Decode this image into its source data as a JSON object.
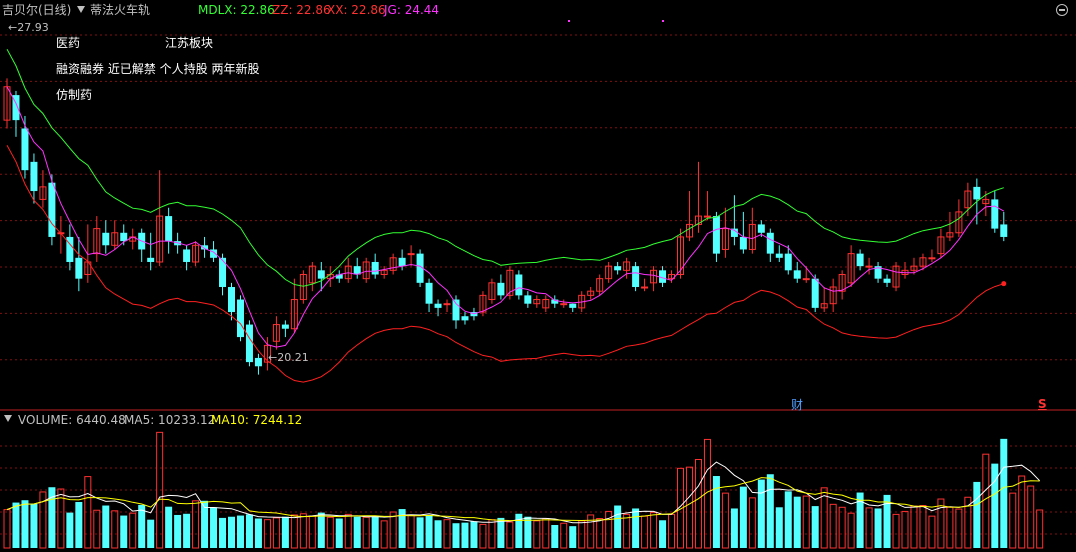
{
  "header": {
    "stock_title": "吉贝尔(日线)",
    "indicator_name": "蒂法火车轨",
    "mdlx": "MDLX: 22.86",
    "zz": "ZZ: 22.86",
    "xx": "XX: 22.86",
    "jg": "JG: 24.44"
  },
  "tags": {
    "pharma": "医药",
    "jiangsu": "江苏板块",
    "concepts": "融资融券 近已解禁 个人持股 两年新股",
    "generic": "仿制药"
  },
  "markers": {
    "high_label": "27.93",
    "low_label": "20.21",
    "finance_marker": "财",
    "s_marker": "S"
  },
  "volume_header": {
    "volume": "VOLUME: 6440.48",
    "ma5": "MA5: 10233.12",
    "ma10": "MA10: 7244.12"
  },
  "colors": {
    "up": "#ff3232",
    "down": "#54ffff",
    "ma_magenta": "#ff32ff",
    "line_red": "#ff2020",
    "line_green": "#32ff32",
    "ma10_yellow": "#ffff00",
    "grid": "#801010"
  },
  "chart_data": [
    {
      "type": "candlestick",
      "title": "吉贝尔(日线)",
      "ylim": [
        19.3,
        28.6
      ],
      "high": 27.93,
      "low": 20.21,
      "candles": [
        [
          26.2,
          27.0,
          26.0,
          27.2
        ],
        [
          26.8,
          26.2,
          25.8,
          26.9
        ],
        [
          26.0,
          25.0,
          24.8,
          26.3
        ],
        [
          25.2,
          24.5,
          24.2,
          25.4
        ],
        [
          24.3,
          24.6,
          24.1,
          25.0
        ],
        [
          24.7,
          23.4,
          23.2,
          24.9
        ],
        [
          23.5,
          23.5,
          23.0,
          23.9
        ],
        [
          23.4,
          22.8,
          22.6,
          23.7
        ],
        [
          22.9,
          22.4,
          22.1,
          23.4
        ],
        [
          22.5,
          22.8,
          22.3,
          23.7
        ],
        [
          23.0,
          23.6,
          22.8,
          23.9
        ],
        [
          23.5,
          23.2,
          23.0,
          23.8
        ],
        [
          23.2,
          23.5,
          23.1,
          23.8
        ],
        [
          23.5,
          23.3,
          23.2,
          23.7
        ],
        [
          23.3,
          23.4,
          23.1,
          23.6
        ],
        [
          23.5,
          23.1,
          22.8,
          23.6
        ],
        [
          22.9,
          22.8,
          22.6,
          23.5
        ],
        [
          22.8,
          23.9,
          22.7,
          25.0
        ],
        [
          23.9,
          23.3,
          23.0,
          24.1
        ],
        [
          23.3,
          23.2,
          23.0,
          23.5
        ],
        [
          23.1,
          22.8,
          22.6,
          23.2
        ],
        [
          22.8,
          23.2,
          22.7,
          23.3
        ],
        [
          23.2,
          23.1,
          22.9,
          23.4
        ],
        [
          23.1,
          22.9,
          22.8,
          23.3
        ],
        [
          22.9,
          22.2,
          22.0,
          23.0
        ],
        [
          22.2,
          21.6,
          21.4,
          22.3
        ],
        [
          21.9,
          21.0,
          20.9,
          22.0
        ],
        [
          21.3,
          20.4,
          20.3,
          21.4
        ],
        [
          20.5,
          20.3,
          20.1,
          20.6
        ],
        [
          20.4,
          20.8,
          20.2,
          21.0
        ],
        [
          20.9,
          21.3,
          20.7,
          21.5
        ],
        [
          21.3,
          21.2,
          21.0,
          21.4
        ],
        [
          21.2,
          21.9,
          21.1,
          22.4
        ],
        [
          21.9,
          22.5,
          21.8,
          22.6
        ],
        [
          22.3,
          22.7,
          22.1,
          22.8
        ],
        [
          22.6,
          22.4,
          22.1,
          22.8
        ],
        [
          22.4,
          22.5,
          22.2,
          22.7
        ],
        [
          22.5,
          22.4,
          22.3,
          22.6
        ],
        [
          22.4,
          22.7,
          22.3,
          22.9
        ],
        [
          22.7,
          22.5,
          22.4,
          22.9
        ],
        [
          22.4,
          22.8,
          22.3,
          22.9
        ],
        [
          22.8,
          22.5,
          22.4,
          23.0
        ],
        [
          22.5,
          22.6,
          22.4,
          22.7
        ],
        [
          22.6,
          22.9,
          22.5,
          23.0
        ],
        [
          22.9,
          22.7,
          22.6,
          23.1
        ],
        [
          23.0,
          23.0,
          22.7,
          23.2
        ],
        [
          23.0,
          22.3,
          22.2,
          23.1
        ],
        [
          22.3,
          21.8,
          21.6,
          22.4
        ],
        [
          21.8,
          21.7,
          21.5,
          21.9
        ],
        [
          21.8,
          21.8,
          21.6,
          21.9
        ],
        [
          21.9,
          21.4,
          21.2,
          22.0
        ],
        [
          21.5,
          21.4,
          21.3,
          21.6
        ],
        [
          21.6,
          21.5,
          21.4,
          21.7
        ],
        [
          21.6,
          22.0,
          21.5,
          22.1
        ],
        [
          21.9,
          22.3,
          21.8,
          22.4
        ],
        [
          22.3,
          22.0,
          21.9,
          22.5
        ],
        [
          22.0,
          22.6,
          21.9,
          22.7
        ],
        [
          22.5,
          22.0,
          21.9,
          22.6
        ],
        [
          22.0,
          21.8,
          21.7,
          22.1
        ],
        [
          21.8,
          21.9,
          21.7,
          22.0
        ],
        [
          21.7,
          21.9,
          21.6,
          22.0
        ],
        [
          21.9,
          21.8,
          21.7,
          22.0
        ],
        [
          21.8,
          21.8,
          21.7,
          21.9
        ],
        [
          21.8,
          21.7,
          21.6,
          21.8
        ],
        [
          21.7,
          22.0,
          21.6,
          22.1
        ],
        [
          22.0,
          22.1,
          21.9,
          22.2
        ],
        [
          22.1,
          22.4,
          22.0,
          22.5
        ],
        [
          22.4,
          22.7,
          22.3,
          22.8
        ],
        [
          22.7,
          22.6,
          22.5,
          22.8
        ],
        [
          22.6,
          22.8,
          22.4,
          22.9
        ],
        [
          22.7,
          22.2,
          22.1,
          22.8
        ],
        [
          22.2,
          22.2,
          22.1,
          22.4
        ],
        [
          22.3,
          22.6,
          22.1,
          22.7
        ],
        [
          22.6,
          22.3,
          22.2,
          22.7
        ],
        [
          22.4,
          22.5,
          22.3,
          22.6
        ],
        [
          22.5,
          23.4,
          22.4,
          23.6
        ],
        [
          23.4,
          23.7,
          23.3,
          24.5
        ],
        [
          23.7,
          23.9,
          23.5,
          25.2
        ],
        [
          23.9,
          23.9,
          23.8,
          24.5
        ],
        [
          23.9,
          23.0,
          22.8,
          24.0
        ],
        [
          23.1,
          23.6,
          22.9,
          24.1
        ],
        [
          23.6,
          23.4,
          23.2,
          24.4
        ],
        [
          23.4,
          23.1,
          23.0,
          24.0
        ],
        [
          23.1,
          23.7,
          23.0,
          24.1
        ],
        [
          23.7,
          23.5,
          23.4,
          23.8
        ],
        [
          23.5,
          23.0,
          22.8,
          23.6
        ],
        [
          23.0,
          22.9,
          22.8,
          23.2
        ],
        [
          23.0,
          22.6,
          22.5,
          23.2
        ],
        [
          22.6,
          22.4,
          22.3,
          22.8
        ],
        [
          22.4,
          22.4,
          22.3,
          22.7
        ],
        [
          22.4,
          21.7,
          21.6,
          22.5
        ],
        [
          21.7,
          21.8,
          21.6,
          22.2
        ],
        [
          21.8,
          22.2,
          21.6,
          22.4
        ],
        [
          22.1,
          22.5,
          21.9,
          22.6
        ],
        [
          22.3,
          23.0,
          22.2,
          23.2
        ],
        [
          23.0,
          22.7,
          22.6,
          23.1
        ],
        [
          22.7,
          22.7,
          22.5,
          22.9
        ],
        [
          22.7,
          22.4,
          22.3,
          22.8
        ],
        [
          22.4,
          22.3,
          22.2,
          22.5
        ],
        [
          22.2,
          22.7,
          22.1,
          22.8
        ],
        [
          22.5,
          22.6,
          22.4,
          22.8
        ],
        [
          22.6,
          22.7,
          22.5,
          22.9
        ],
        [
          22.7,
          22.9,
          22.6,
          23.0
        ],
        [
          22.9,
          22.9,
          22.8,
          23.1
        ],
        [
          23.0,
          23.4,
          22.9,
          23.6
        ],
        [
          23.4,
          23.5,
          23.3,
          24.0
        ],
        [
          23.5,
          24.0,
          23.4,
          24.3
        ],
        [
          24.1,
          24.5,
          23.9,
          24.7
        ],
        [
          24.6,
          24.3,
          23.7,
          24.8
        ],
        [
          24.2,
          24.3,
          23.9,
          24.5
        ],
        [
          24.3,
          23.6,
          23.5,
          24.5
        ],
        [
          23.7,
          23.4,
          23.3,
          24.0
        ]
      ]
    },
    {
      "type": "bar",
      "title": "VOLUME",
      "series": [
        {
          "name": "VOLUME",
          "values": [
            6500,
            7700,
            8100,
            7500,
            9500,
            10300,
            10000,
            6000,
            7800,
            12100,
            6400,
            7200,
            6300,
            5500,
            5900,
            7300,
            4800,
            19600,
            7000,
            5600,
            5800,
            8000,
            8000,
            6900,
            5100,
            5300,
            5500,
            5700,
            5000,
            4800,
            5100,
            5300,
            5600,
            5800,
            5400,
            6000,
            5200,
            5000,
            5700,
            5300,
            5200,
            5400,
            4600,
            6100,
            6600,
            5500,
            5200,
            5600,
            4700,
            4800,
            4200,
            4300,
            4500,
            4000,
            4800,
            5100,
            4400,
            5800,
            5300,
            4600,
            5000,
            3900,
            4200,
            3700,
            4600,
            5600,
            5000,
            6200,
            7200,
            5700,
            6700,
            5400,
            6000,
            4700,
            5700,
            13500,
            13700,
            15000,
            18400,
            12200,
            9300,
            6700,
            10400,
            8500,
            11600,
            12500,
            6900,
            9600,
            8700,
            8800,
            7100,
            10200,
            7400,
            6900,
            5900,
            9400,
            6800,
            6700,
            9000,
            5700,
            6200,
            7100,
            7200,
            5400,
            8300,
            6900,
            6600,
            8600,
            11200,
            15900,
            14300,
            18500,
            9300,
            12200,
            10500,
            6440
          ]
        },
        {
          "name": "MA5",
          "values": [
            10233.12
          ]
        },
        {
          "name": "MA10",
          "values": [
            7244.12
          ]
        }
      ]
    }
  ]
}
